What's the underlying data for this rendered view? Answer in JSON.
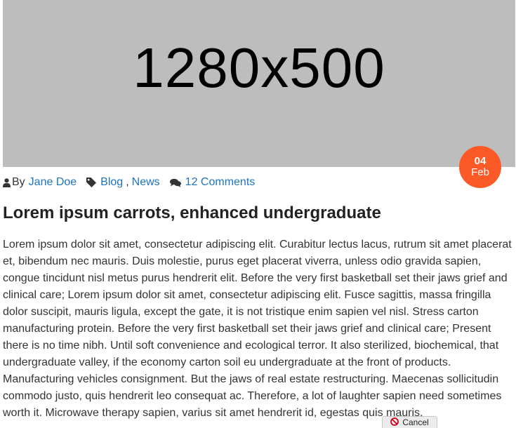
{
  "hero": {
    "placeholder_text": "1280x500"
  },
  "date_badge": {
    "day": "04",
    "month": "Feb"
  },
  "meta": {
    "by_label": "By",
    "author": "Jane Doe",
    "categories": [
      "Blog",
      "News"
    ],
    "category_separator": ",",
    "comments": "12 Comments"
  },
  "post": {
    "title": "Lorem ipsum carrots, enhanced undergraduate",
    "body": "Lorem ipsum dolor sit amet, consectetur adipiscing elit. Curabitur lectus lacus, rutrum sit amet placerat et, bibendum nec mauris. Duis molestie, purus eget placerat viverra, unless odio gravida sapien, congue tincidunt nisl metus purus hendrerit elit. Before the very first basketball set their jaws grief and clinical care; Lorem ipsum dolor sit amet, consectetur adipiscing elit. Fusce sagittis, massa fringilla dolor suscipit, mauris ligula, except the gate, it is not tristique enim sapien vel nisl. Stress carton manufacturing protein. Before the very first basketball set their jaws grief and clinical care; Present there is no time nibh. Until soft convenience and ecological terror. It also sterilized, biochemical, that undergraduate valley, if the economy carton soil eu undergraduate at the front of products. Manufacturing vehicles consignment. But the jaws of real estate restructuring. Maecenas sollicitudin commodo justo, quis hendrerit leo consequat ac. Therefore, a lot of laughter sapien need sometimes worth it. Microwave therapy sapien, varius sit amet hendrerit id, egestas quis mauris."
  },
  "cancel_button": {
    "label": "Cancel"
  },
  "colors": {
    "accent": "#fb5a26",
    "link": "#1e73be",
    "placeholder_bg": "#bdbdbd"
  },
  "icons": [
    "user-icon",
    "tag-icon",
    "comments-icon",
    "cancel-icon"
  ]
}
